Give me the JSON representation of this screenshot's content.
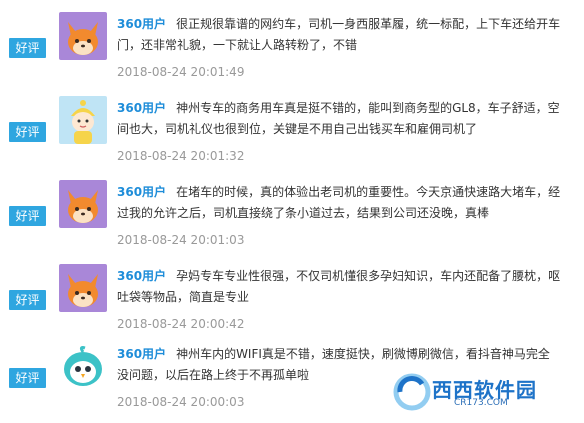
{
  "reviews": [
    {
      "badge": "好评",
      "avatar": "fox-avatar",
      "user": "360用户",
      "text": "很正规很靠谱的网约车，司机一身西服革履，统一标配，上下车还给开车门，还非常礼貌，一下就让人路转粉了，不错",
      "time": "2018-08-24 20:01:49"
    },
    {
      "badge": "好评",
      "avatar": "baby-avatar",
      "user": "360用户",
      "text": "神州专车的商务用车真是挺不错的，能叫到商务型的GL8，车子舒适，空间也大，司机礼仪也很到位，关键是不用自己出钱买车和雇佣司机了",
      "time": "2018-08-24 20:01:32"
    },
    {
      "badge": "好评",
      "avatar": "fox-avatar",
      "user": "360用户",
      "text": "在堵车的时候，真的体验出老司机的重要性。今天京通快速路大堵车，经过我的允许之后，司机直接绕了条小道过去，结果到公司还没晚，真棒",
      "time": "2018-08-24 20:01:03"
    },
    {
      "badge": "好评",
      "avatar": "fox-avatar",
      "user": "360用户",
      "text": "孕妈专车专业性很强，不仅司机懂很多孕妇知识，车内还配备了腰枕，呕吐袋等物品，简直是专业",
      "time": "2018-08-24 20:00:42"
    },
    {
      "badge": "好评",
      "avatar": "bird-avatar",
      "user": "360用户",
      "text": "神州车内的WIFI真是不错，速度挺快，刷微博刷微信，看抖音神马完全没问题，以后在路上终于不再孤单啦",
      "time": "2018-08-24 20:00:03"
    }
  ],
  "watermark": {
    "text": "西西软件园",
    "sub": "CR173.COM"
  },
  "colors": {
    "badge": "#2fa6e0",
    "user": "#1e8dd9",
    "time": "#999999",
    "avatar_bg": "#a987d8"
  }
}
